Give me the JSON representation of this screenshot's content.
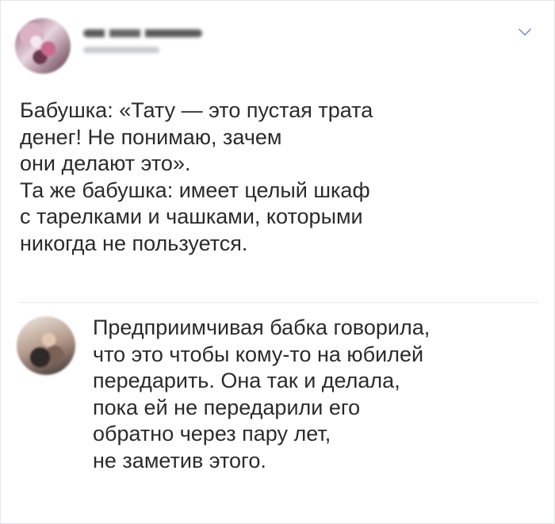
{
  "post": {
    "author_name_redacted": true,
    "lines": [
      "Бабушка: «Тату — это пустая трата",
      "денег! Не понимаю, зачем",
      "они делают это».",
      "Та же бабушка: имеет целый шкаф",
      "с тарелками и чашками, которыми",
      "никогда не пользуется."
    ]
  },
  "reply": {
    "lines": [
      "Предприимчивая бабка говорила,",
      "что это чтобы кому-то на юбилей",
      "передарить. Она так и делала,",
      "пока ей не передарили его",
      "обратно через пару лет,",
      "не заметив этого."
    ]
  },
  "icons": {
    "options": "chevron-down-icon"
  },
  "colors": {
    "text": "#2b2b2b",
    "divider": "#e7e8ec",
    "chevron": "#8a9bb0"
  }
}
